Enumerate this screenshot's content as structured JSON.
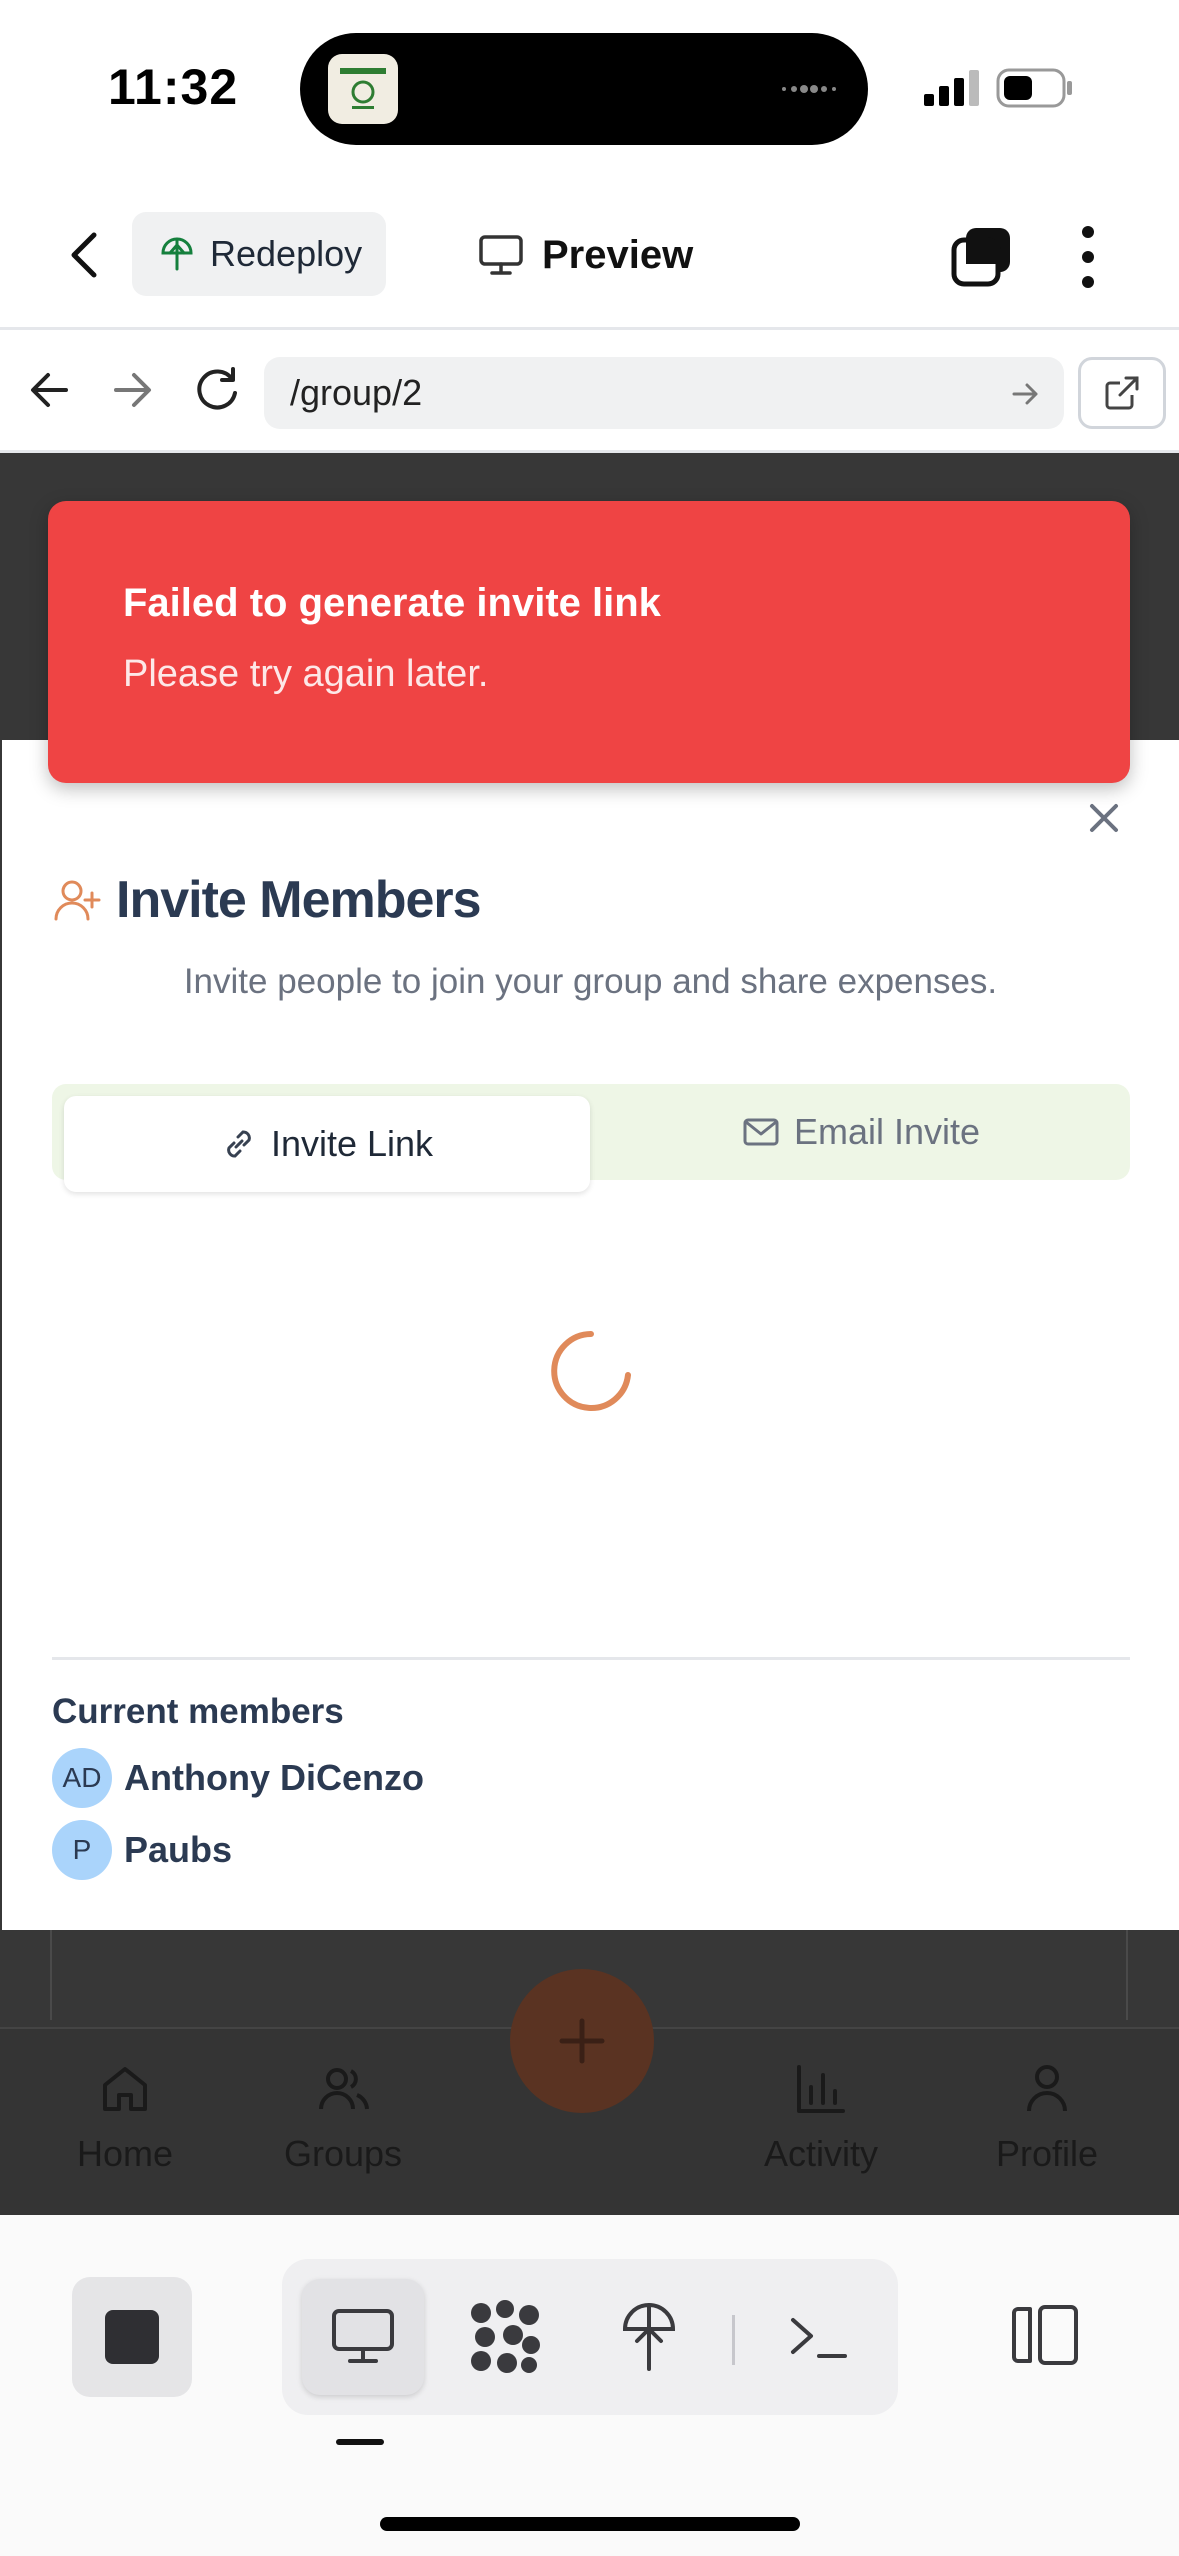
{
  "status_bar": {
    "time": "11:32"
  },
  "app_bar": {
    "redeploy_label": "Redeploy",
    "preview_label": "Preview"
  },
  "browser": {
    "url": "/group/2"
  },
  "toast": {
    "title": "Failed to generate invite link",
    "description": "Please try again later."
  },
  "modal": {
    "title": "Invite Members",
    "subtitle": "Invite people to join your group and share expenses.",
    "tabs": [
      {
        "label": "Invite Link",
        "active": true
      },
      {
        "label": "Email Invite",
        "active": false
      }
    ],
    "members_heading": "Current members",
    "members": [
      {
        "initials": "AD",
        "name": "Anthony DiCenzo"
      },
      {
        "initials": "P",
        "name": "Paubs"
      }
    ]
  },
  "app_nav": {
    "items": [
      {
        "label": "Home",
        "icon": "home-icon"
      },
      {
        "label": "Groups",
        "icon": "users-icon"
      },
      {
        "label": "Activity",
        "icon": "bar-chart-icon"
      },
      {
        "label": "Profile",
        "icon": "user-icon"
      }
    ]
  },
  "colors": {
    "toast": "#ef4444",
    "accent_orange": "#e08a5a",
    "tab_bg": "#eef6e6",
    "avatar_bg": "#aad4fb",
    "overlay": "#373737"
  }
}
